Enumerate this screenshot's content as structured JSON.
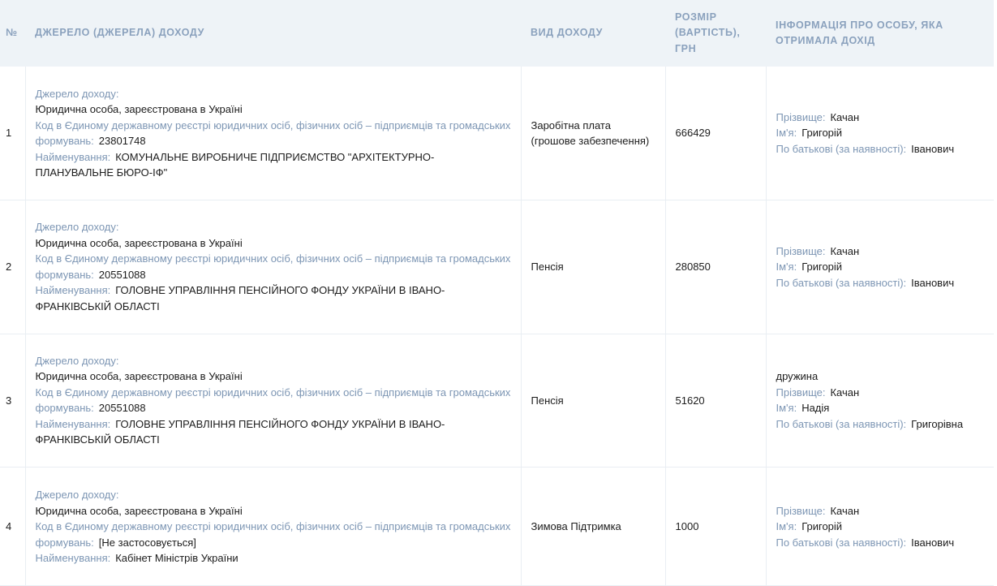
{
  "header": {
    "num": "№",
    "source": "ДЖЕРЕЛО (ДЖЕРЕЛА) ДОХОДУ",
    "type": "ВИД ДОХОДУ",
    "amount": "РОЗМІР (ВАРТІСТЬ), ГРН",
    "person": "ІНФОРМАЦІЯ ПРО ОСОБУ, ЯКА ОТРИМАЛА ДОХІД"
  },
  "labels": {
    "source_label": "Джерело доходу:",
    "code_label": "Код в Єдиному державному реєстрі юридичних осіб, фізичних осіб – підприємців та громадських формувань:",
    "name_label": "Найменування:",
    "surname_label": "Прізвище:",
    "firstname_label": "Ім'я:",
    "patronymic_label": "По батькові (за наявності):"
  },
  "rows": [
    {
      "num": "1",
      "source_type": "Юридична особа, зареєстрована в Україні",
      "code": "23801748",
      "name": "КОМУНАЛЬНЕ ВИРОБНИЧЕ ПІДПРИЄМСТВО \"АРХІТЕКТУРНО-ПЛАНУВАЛЬНЕ БЮРО-ІФ\"",
      "income_type": "Заробітна плата (грошове забезпечення)",
      "amount": "666429",
      "relation": "",
      "surname": "Качан",
      "firstname": "Григорій",
      "patronymic": "Іванович"
    },
    {
      "num": "2",
      "source_type": "Юридична особа, зареєстрована в Україні",
      "code": "20551088",
      "name": "ГОЛОВНЕ УПРАВЛІННЯ ПЕНСІЙНОГО ФОНДУ УКРАЇНИ В ІВАНО-ФРАНКІВСЬКІЙ ОБЛАСТІ",
      "income_type": "Пенсія",
      "amount": "280850",
      "relation": "",
      "surname": "Качан",
      "firstname": "Григорій",
      "patronymic": "Іванович"
    },
    {
      "num": "3",
      "source_type": "Юридична особа, зареєстрована в Україні",
      "code": "20551088",
      "name": "ГОЛОВНЕ УПРАВЛІННЯ ПЕНСІЙНОГО ФОНДУ УКРАЇНИ В ІВАНО-ФРАНКІВСЬКІЙ ОБЛАСТІ",
      "income_type": "Пенсія",
      "amount": "51620",
      "relation": "дружина",
      "surname": "Качан",
      "firstname": "Надія",
      "patronymic": "Григорівна"
    },
    {
      "num": "4",
      "source_type": "Юридична особа, зареєстрована в Україні",
      "code": "[Не застосовується]",
      "name": "Кабінет Міністрів України",
      "income_type": "Зимова Підтримка",
      "amount": "1000",
      "relation": "",
      "surname": "Качан",
      "firstname": "Григорій",
      "patronymic": "Іванович"
    }
  ]
}
